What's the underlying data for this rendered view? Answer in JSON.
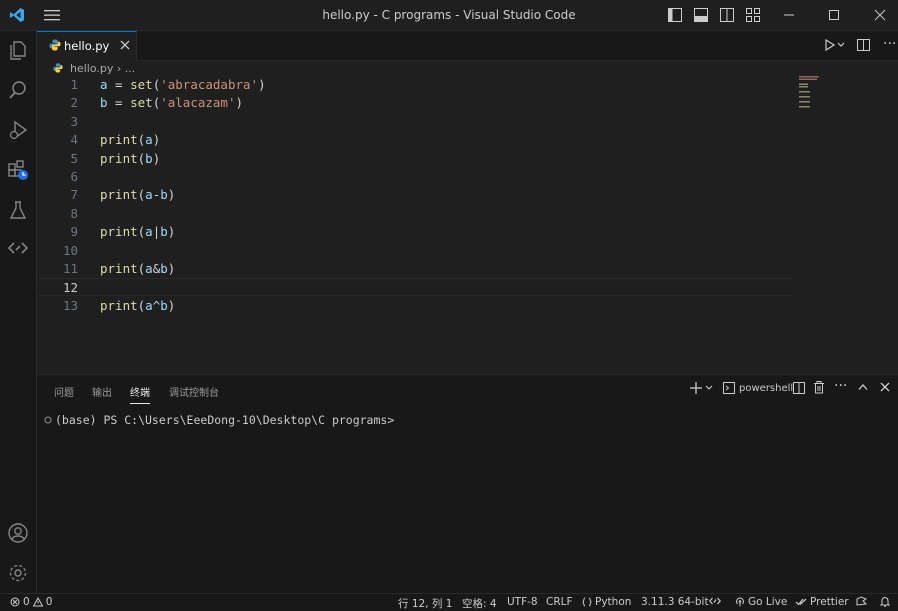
{
  "window": {
    "title": "hello.py - C programs - Visual Studio Code"
  },
  "tab": {
    "label": "hello.py"
  },
  "breadcrumb": {
    "file": "hello.py",
    "separator": "›",
    "more": "..."
  },
  "editor": {
    "active_line": 12,
    "lines": [
      {
        "n": "1",
        "tokens": [
          {
            "t": "a",
            "c": "var"
          },
          {
            "t": " = ",
            "c": "op"
          },
          {
            "t": "set",
            "c": "fn"
          },
          {
            "t": "(",
            "c": "op"
          },
          {
            "t": "'abracadabra'",
            "c": "str"
          },
          {
            "t": ")",
            "c": "op"
          }
        ]
      },
      {
        "n": "2",
        "tokens": [
          {
            "t": "b",
            "c": "var"
          },
          {
            "t": " = ",
            "c": "op"
          },
          {
            "t": "set",
            "c": "fn"
          },
          {
            "t": "(",
            "c": "op"
          },
          {
            "t": "'alacazam'",
            "c": "str"
          },
          {
            "t": ")",
            "c": "op"
          }
        ]
      },
      {
        "n": "3",
        "tokens": []
      },
      {
        "n": "4",
        "tokens": [
          {
            "t": "print",
            "c": "fn"
          },
          {
            "t": "(",
            "c": "op"
          },
          {
            "t": "a",
            "c": "var"
          },
          {
            "t": ")",
            "c": "op"
          }
        ]
      },
      {
        "n": "5",
        "tokens": [
          {
            "t": "print",
            "c": "fn"
          },
          {
            "t": "(",
            "c": "op"
          },
          {
            "t": "b",
            "c": "var"
          },
          {
            "t": ")",
            "c": "op"
          }
        ]
      },
      {
        "n": "6",
        "tokens": []
      },
      {
        "n": "7",
        "tokens": [
          {
            "t": "print",
            "c": "fn"
          },
          {
            "t": "(",
            "c": "op"
          },
          {
            "t": "a",
            "c": "var"
          },
          {
            "t": "-",
            "c": "op"
          },
          {
            "t": "b",
            "c": "var"
          },
          {
            "t": ")",
            "c": "op"
          }
        ]
      },
      {
        "n": "8",
        "tokens": []
      },
      {
        "n": "9",
        "tokens": [
          {
            "t": "print",
            "c": "fn"
          },
          {
            "t": "(",
            "c": "op"
          },
          {
            "t": "a",
            "c": "var"
          },
          {
            "t": "|",
            "c": "op"
          },
          {
            "t": "b",
            "c": "var"
          },
          {
            "t": ")",
            "c": "op"
          }
        ]
      },
      {
        "n": "10",
        "tokens": []
      },
      {
        "n": "11",
        "tokens": [
          {
            "t": "print",
            "c": "fn"
          },
          {
            "t": "(",
            "c": "op"
          },
          {
            "t": "a",
            "c": "var"
          },
          {
            "t": "&",
            "c": "op"
          },
          {
            "t": "b",
            "c": "var"
          },
          {
            "t": ")",
            "c": "op"
          }
        ]
      },
      {
        "n": "12",
        "tokens": []
      },
      {
        "n": "13",
        "tokens": [
          {
            "t": "print",
            "c": "fn"
          },
          {
            "t": "(",
            "c": "op"
          },
          {
            "t": "a",
            "c": "var"
          },
          {
            "t": "^",
            "c": "op"
          },
          {
            "t": "b",
            "c": "var"
          },
          {
            "t": ")",
            "c": "op"
          }
        ]
      }
    ]
  },
  "panel": {
    "tabs": [
      "问题",
      "输出",
      "终端",
      "调试控制台"
    ],
    "active_tab": "终端",
    "terminal_name": "powershell",
    "prompt": "(base) PS C:\\Users\\EeeDong-10\\Desktop\\C programs>"
  },
  "statusbar": {
    "errors": "0",
    "warnings": "0",
    "position": "行 12, 列 1",
    "spaces": "空格: 4",
    "encoding": "UTF-8",
    "eol": "CRLF",
    "language": "Python",
    "interpreter": "3.11.3 64-bit",
    "golive": "Go Live",
    "prettier": "Prettier"
  },
  "colors": {
    "accent": "#0078d4",
    "background": "#1f1f1f",
    "sidebar": "#181818"
  },
  "icons": {
    "activity": [
      "explorer-icon",
      "search-icon",
      "run-debug-icon",
      "extensions-icon",
      "testing-icon",
      "remote-icon",
      "account-icon",
      "settings-gear-icon"
    ]
  }
}
